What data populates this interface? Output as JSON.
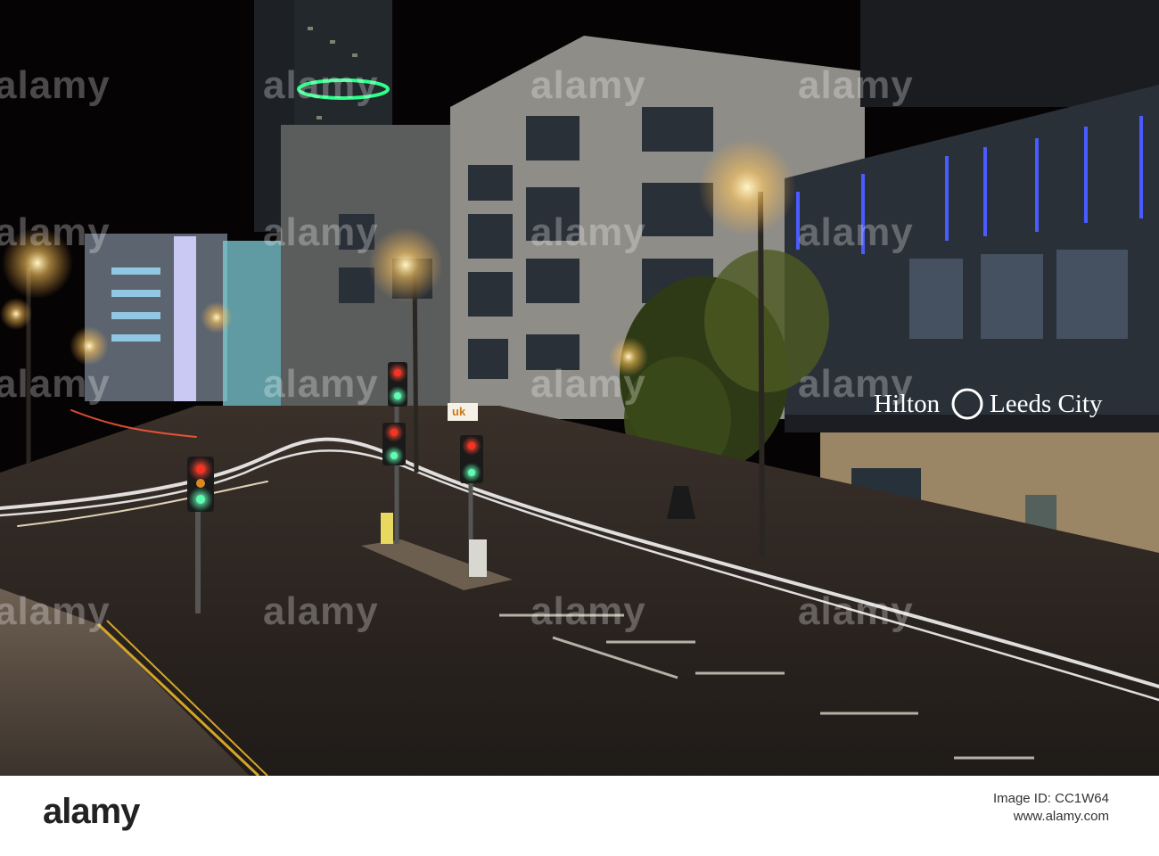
{
  "scene": {
    "description_free": true,
    "hotel_sign": "Hilton",
    "hotel_sign_right": "Leeds City",
    "shop_sign": "uk",
    "colors": {
      "sky": "#060304",
      "road": "#2a2420",
      "blue_neon": "#3a4dff",
      "street_light": "#ffcf6a",
      "red_light": "#ff2a1a",
      "green_light": "#27ff9a"
    }
  },
  "watermarks": [
    "alamy",
    "alamy",
    "alamy",
    "alamy",
    "alamy",
    "alamy",
    "alamy",
    "alamy",
    "alamy",
    "alamy",
    "alamy",
    "alamy",
    "alamy",
    "alamy",
    "alamy",
    "alamy"
  ],
  "footer": {
    "logo": "alamy",
    "image_id": "Image ID: CC1W64",
    "url": "www.alamy.com"
  }
}
